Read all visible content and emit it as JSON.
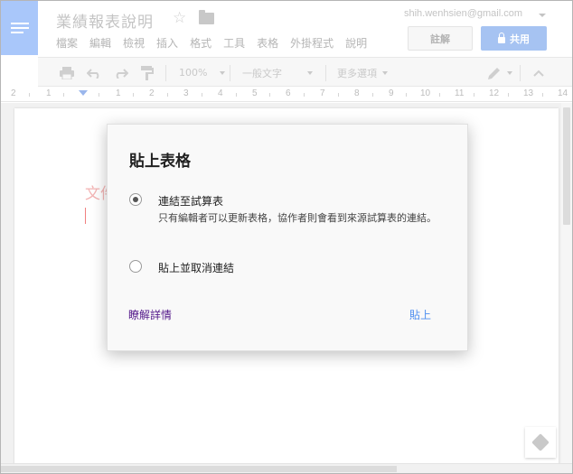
{
  "header": {
    "doc_title": "業績報表說明",
    "account_email": "shih.wenhsien@gmail.com",
    "comment_label": "註解",
    "share_label": "共用"
  },
  "menu": [
    "檔案",
    "編輯",
    "檢視",
    "插入",
    "格式",
    "工具",
    "表格",
    "外掛程式",
    "說明"
  ],
  "toolbar": {
    "zoom": "100%",
    "style": "一般文字",
    "more_options": "更多選項"
  },
  "ruler": {
    "labels": [
      "2",
      "1",
      "1",
      "2",
      "3",
      "4",
      "5",
      "6",
      "7",
      "8",
      "9",
      "10",
      "11",
      "12",
      "13",
      "14"
    ]
  },
  "document": {
    "visible_text": "文件"
  },
  "dialog": {
    "title": "貼上表格",
    "option_link_label": "連結至試算表",
    "option_link_desc": "只有編輯者可以更新表格，協作者則會看到來源試算表的連結。",
    "option_unlink_label": "貼上並取消連結",
    "learn_more": "瞭解詳情",
    "paste": "貼上"
  },
  "colors": {
    "docs_blue": "#4285f4",
    "share_button": "#a6c3f2",
    "link_purple": "#551a8b",
    "paste_blue": "#4d8ef0"
  }
}
